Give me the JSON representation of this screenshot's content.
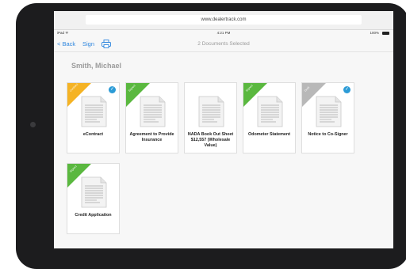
{
  "browser": {
    "url": "www.dealertrack.com"
  },
  "status_bar": {
    "device": "iPad ᯤ",
    "time": "4:21 PM",
    "battery": "100%"
  },
  "nav": {
    "back_label": "< Back",
    "sign_label": "Sign",
    "print_icon": "printer-icon",
    "title": "2 Documents Selected"
  },
  "customer_name": "Smith, Michael",
  "colors": {
    "signed": "#5ab83f",
    "pending": "#f5b324",
    "draft": "#b8b8b8",
    "selected": "#2b9bd6",
    "link": "#2e86de"
  },
  "documents": [
    {
      "label": "eContract",
      "ribbon": "Contract",
      "ribbon_color": "#f5b324",
      "selected": true
    },
    {
      "label": "Agreement to Provide Insurance",
      "ribbon": "Signed",
      "ribbon_color": "#5ab83f",
      "selected": false
    },
    {
      "label": "NADA Book Out Sheet $12,557 (Wholesale Value)",
      "ribbon": "",
      "ribbon_color": "",
      "selected": false
    },
    {
      "label": "Odometer Statement",
      "ribbon": "Signed",
      "ribbon_color": "#5ab83f",
      "selected": false
    },
    {
      "label": "Notice to Co-Signer",
      "ribbon": "Draft",
      "ribbon_color": "#b8b8b8",
      "selected": true
    },
    {
      "label": "Credit Application",
      "ribbon": "Signed",
      "ribbon_color": "#5ab83f",
      "selected": false
    }
  ]
}
